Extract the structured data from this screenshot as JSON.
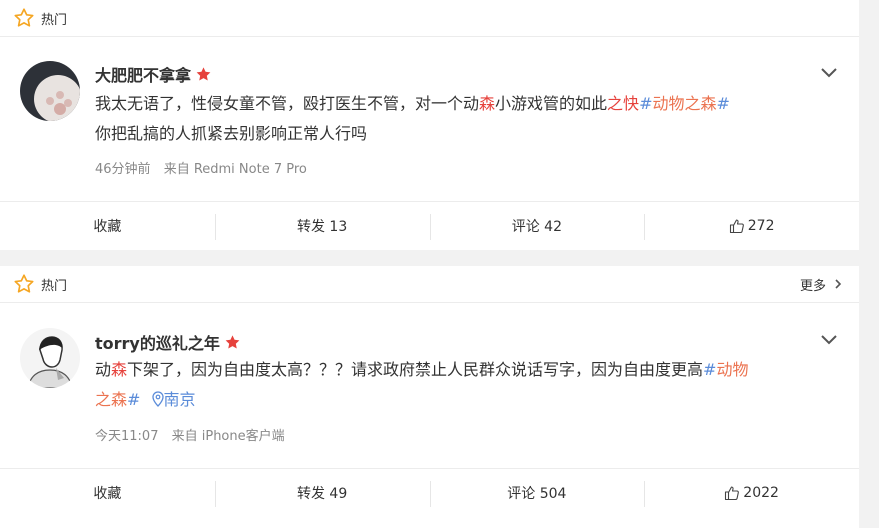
{
  "posts": [
    {
      "hot_label": "热门",
      "username": "大肥肥不拿拿",
      "content_line1": [
        {
          "text": "我太无语了，性侵女童不管，殴打医生不管，对一个动",
          "style": "normal"
        },
        {
          "text": "森",
          "style": "red"
        },
        {
          "text": "小游戏管的如此",
          "style": "normal"
        },
        {
          "text": "之快",
          "style": "red"
        }
      ],
      "topic_hash_open": "#",
      "topic_text": "动物之森",
      "topic_hash_close": "#",
      "content_line2": "你把乱搞的人抓紧去别影响正常人行吗",
      "time": "46分钟前",
      "source": "来自 Redmi Note 7 Pro",
      "actions": {
        "favorite": "收藏",
        "repost": "转发 13",
        "comment": "评论 42",
        "like": "272"
      }
    },
    {
      "hot_label": "热门",
      "more_label": "更多",
      "username": "torry的巡礼之年",
      "content_line1": [
        {
          "text": "动",
          "style": "normal"
        },
        {
          "text": "森",
          "style": "red"
        },
        {
          "text": "下架了，因为自由度太高？？？请求政府禁止人民群众说话写字，因为自由度更高",
          "style": "normal"
        }
      ],
      "topic_hash_open": "#",
      "topic_text_part1": "动物",
      "topic_text_part2_a": "之",
      "topic_text_part2_b": "森",
      "topic_hash_close": "#",
      "location": "南京",
      "time": "今天11:07",
      "source": "来自 iPhone客户端",
      "actions": {
        "favorite": "收藏",
        "repost": "转发 49",
        "comment": "评论 504",
        "like": "2022"
      }
    }
  ],
  "colors": {
    "accent_red": "#e6423c",
    "topic_orange": "#eb7350",
    "link_blue": "#5b8cd9",
    "hot_star": "#f5a623"
  },
  "icons": [
    "hot-star-icon",
    "vip-badge-icon",
    "chevron-down-icon",
    "chevron-right-icon",
    "thumbs-up-icon",
    "location-pin-icon"
  ]
}
